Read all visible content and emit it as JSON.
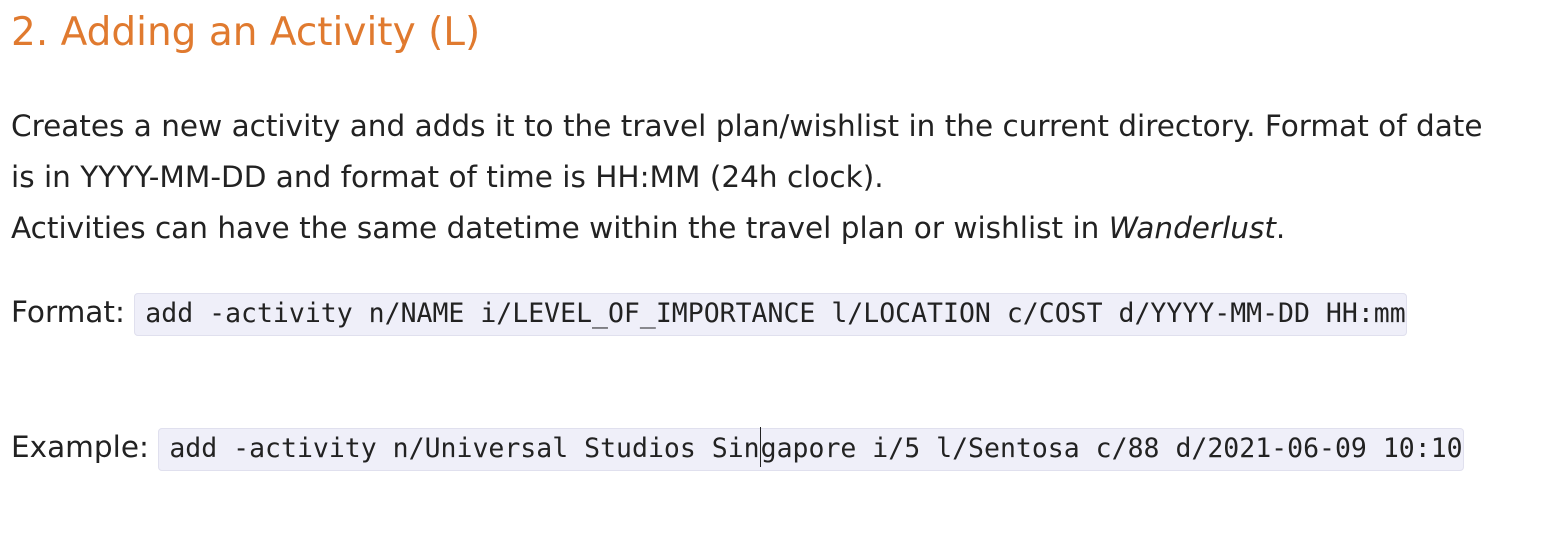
{
  "heading": "2. Adding an Activity (L)",
  "description": {
    "line1": "Creates a new activity and adds it to the travel plan/wishlist in the current directory. Format of date",
    "line2": "is in YYYY-MM-DD and format of time is HH:MM (24h clock).",
    "line3_prefix": "Activities can have the same datetime within the travel plan or wishlist in ",
    "line3_emphasis": "Wanderlust",
    "line3_suffix": "."
  },
  "format": {
    "label": "Format:",
    "command": "add -activity n/NAME i/LEVEL_OF_IMPORTANCE l/LOCATION c/COST d/YYYY-MM-DD HH:mm"
  },
  "example": {
    "label": "Example:",
    "command_before_cursor": "add -activity n/Universal Studios Sin",
    "command_after_cursor": "gapore i/5 l/Sentosa c/88 d/2021-06-09 10:10"
  },
  "colors": {
    "heading": "#e07a2f",
    "text": "#222222",
    "code_background": "#efeff9"
  }
}
